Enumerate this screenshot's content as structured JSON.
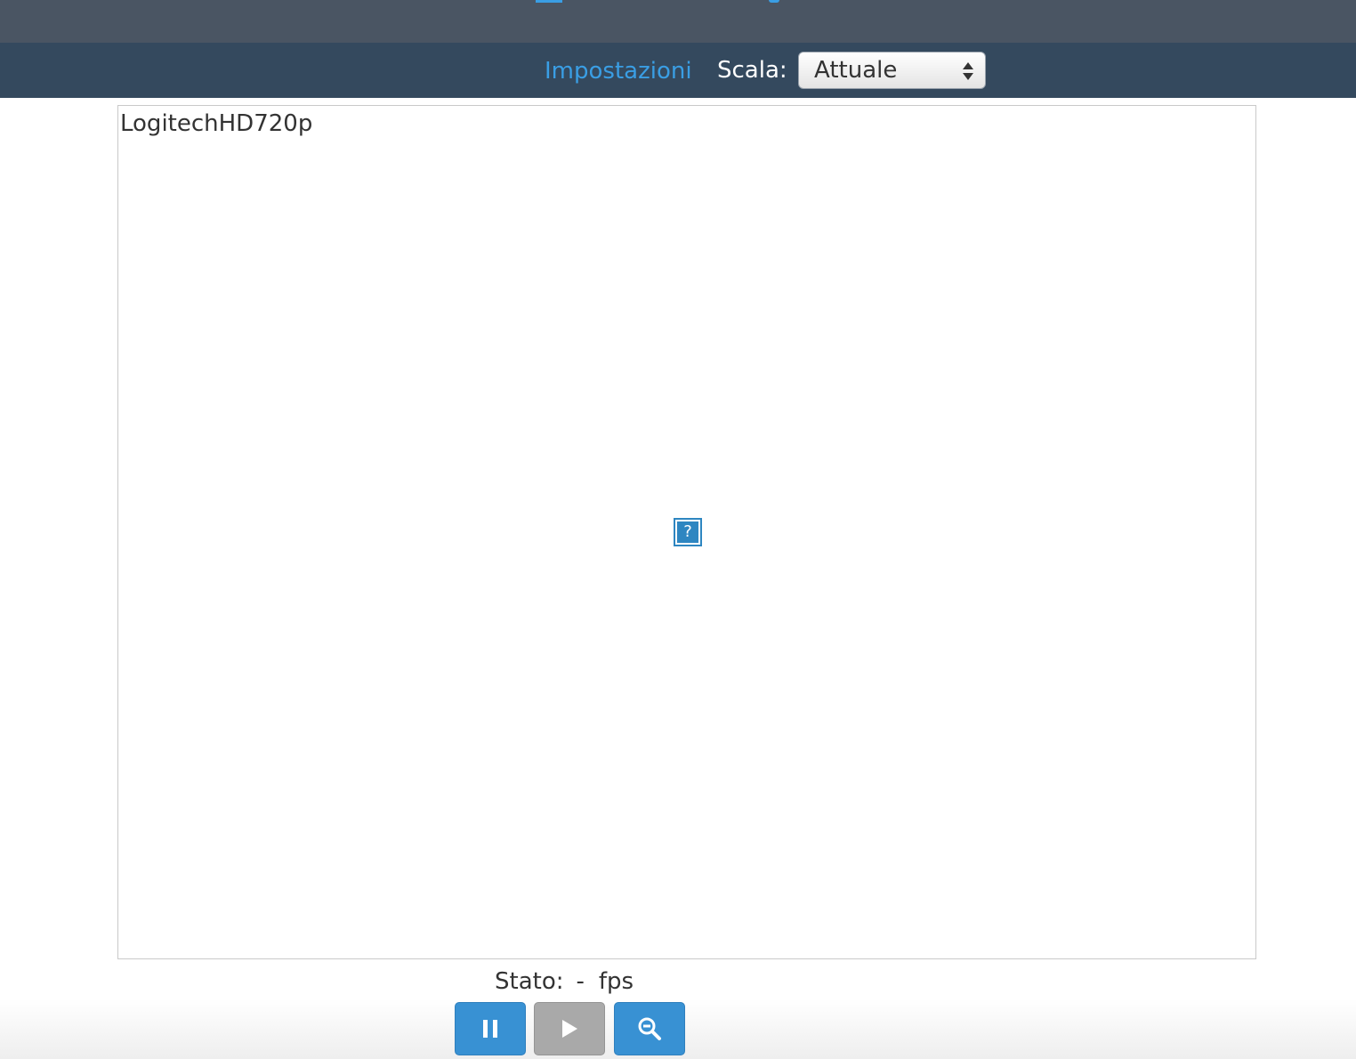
{
  "header": {
    "settings_link": "Impostazioni",
    "scale_label": "Scala:",
    "scale_select": {
      "selected": "Attuale"
    }
  },
  "viewer": {
    "camera_name": "LogitechHD720p",
    "image_placeholder_glyph": "?"
  },
  "status": {
    "label": "Stato:",
    "value": "-",
    "unit": "fps"
  },
  "controls": {
    "pause_icon": "pause-icon",
    "play_icon": "play-icon",
    "zoom_icon": "zoom-out-icon"
  },
  "colors": {
    "top_bar": "#4a5563",
    "sub_bar": "#34495e",
    "accent": "#3a9ee4",
    "button_blue": "#3891d3",
    "button_disabled": "#a9a9a9"
  }
}
